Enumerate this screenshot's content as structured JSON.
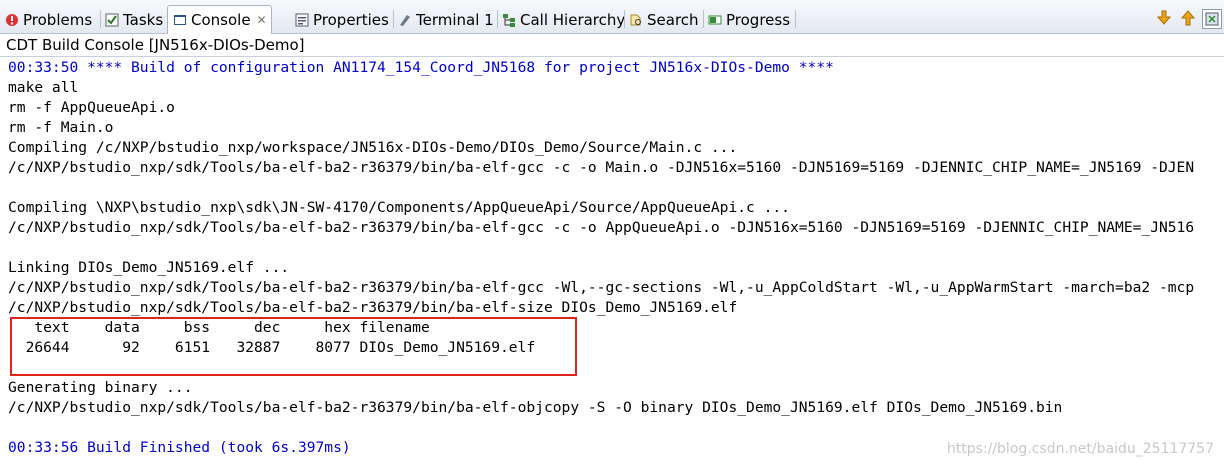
{
  "tabs": [
    {
      "label": "Problems",
      "icon": "problems-icon"
    },
    {
      "label": "Tasks",
      "icon": "tasks-icon"
    },
    {
      "label": "Console",
      "icon": "console-icon",
      "active": true
    },
    {
      "label": "Properties",
      "icon": "properties-icon"
    },
    {
      "label": "Terminal 1",
      "icon": "terminal-icon"
    },
    {
      "label": "Call Hierarchy",
      "icon": "call-hierarchy-icon"
    },
    {
      "label": "Search",
      "icon": "search-icon"
    },
    {
      "label": "Progress",
      "icon": "progress-icon"
    }
  ],
  "toolbar": [
    "scroll-down-icon",
    "scroll-up-icon",
    "pin-icon"
  ],
  "console": {
    "title": "CDT Build Console [JN516x-DIOs-Demo]",
    "lines": [
      "00:33:50 **** Build of configuration AN1174_154_Coord_JN5168 for project JN516x-DIOs-Demo ****",
      "make all",
      "rm -f AppQueueApi.o",
      "rm -f Main.o",
      "Compiling /c/NXP/bstudio_nxp/workspace/JN516x-DIOs-Demo/DIOs_Demo/Source/Main.c ...",
      "/c/NXP/bstudio_nxp/sdk/Tools/ba-elf-ba2-r36379/bin/ba-elf-gcc -c -o Main.o -DJN516x=5160 -DJN5169=5169 -DJENNIC_CHIP_NAME=_JN5169 -DJEN",
      "",
      "Compiling \\NXP\\bstudio_nxp\\sdk\\JN-SW-4170/Components/AppQueueApi/Source/AppQueueApi.c ...",
      "/c/NXP/bstudio_nxp/sdk/Tools/ba-elf-ba2-r36379/bin/ba-elf-gcc -c -o AppQueueApi.o -DJN516x=5160 -DJN5169=5169 -DJENNIC_CHIP_NAME=_JN516",
      "",
      "Linking DIOs_Demo_JN5169.elf ...",
      "/c/NXP/bstudio_nxp/sdk/Tools/ba-elf-ba2-r36379/bin/ba-elf-gcc -Wl,--gc-sections -Wl,-u_AppColdStart -Wl,-u_AppWarmStart -march=ba2 -mcp",
      "/c/NXP/bstudio_nxp/sdk/Tools/ba-elf-ba2-r36379/bin/ba-elf-size DIOs_Demo_JN5169.elf",
      "   text    data     bss     dec     hex filename",
      "  26644      92    6151   32887    8077 DIOs_Demo_JN5169.elf",
      "",
      "Generating binary ...",
      "/c/NXP/bstudio_nxp/sdk/Tools/ba-elf-ba2-r36379/bin/ba-elf-objcopy -S -O binary DIOs_Demo_JN5169.elf DIOs_Demo_JN5169.bin",
      "",
      "00:33:56 Build Finished (took 6s.397ms)"
    ],
    "blue_lines": [
      0,
      19
    ]
  },
  "watermark": "https://blog.csdn.net/baidu_25117757",
  "colors": {
    "console_blue": "#0000cc",
    "highlight_border": "#e2231a"
  }
}
